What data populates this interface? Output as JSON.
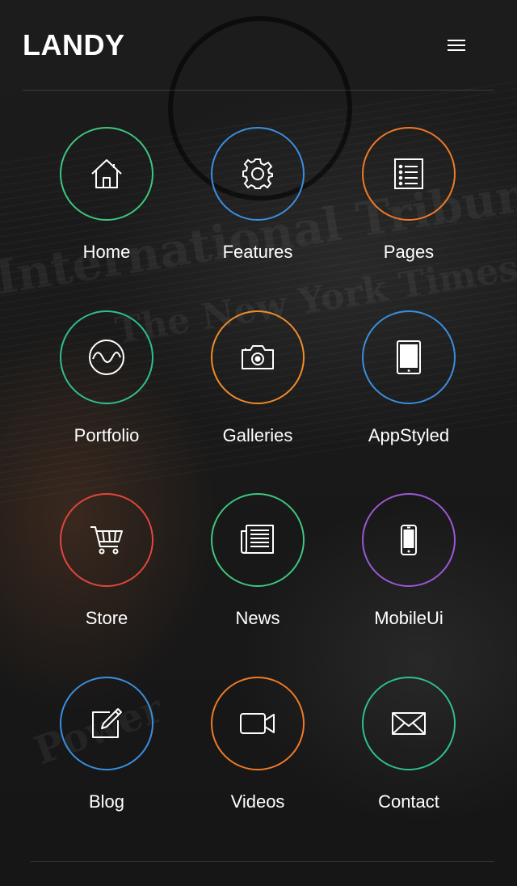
{
  "header": {
    "logo": "LANDY",
    "menu_icon": "hamburger-menu-icon"
  },
  "menu": [
    {
      "id": "home",
      "label": "Home",
      "icon": "home-icon",
      "color": "#3ec77e"
    },
    {
      "id": "features",
      "label": "Features",
      "icon": "gear-icon",
      "color": "#3a8fe0"
    },
    {
      "id": "pages",
      "label": "Pages",
      "icon": "list-icon",
      "color": "#f07a26"
    },
    {
      "id": "portfolio",
      "label": "Portfolio",
      "icon": "wave-icon",
      "color": "#2fbf8f"
    },
    {
      "id": "galleries",
      "label": "Galleries",
      "icon": "camera-icon",
      "color": "#f08c2a"
    },
    {
      "id": "appstyled",
      "label": "AppStyled",
      "icon": "tablet-icon",
      "color": "#3a8fe0"
    },
    {
      "id": "store",
      "label": "Store",
      "icon": "cart-icon",
      "color": "#e2463f"
    },
    {
      "id": "news",
      "label": "News",
      "icon": "newspaper-icon",
      "color": "#3ec77e"
    },
    {
      "id": "mobileui",
      "label": "MobileUi",
      "icon": "phone-icon",
      "color": "#9b59d6"
    },
    {
      "id": "blog",
      "label": "Blog",
      "icon": "edit-icon",
      "color": "#3a8fe0"
    },
    {
      "id": "videos",
      "label": "Videos",
      "icon": "video-camera-icon",
      "color": "#f07a26"
    },
    {
      "id": "contact",
      "label": "Contact",
      "icon": "envelope-icon",
      "color": "#2fbf8f"
    }
  ]
}
